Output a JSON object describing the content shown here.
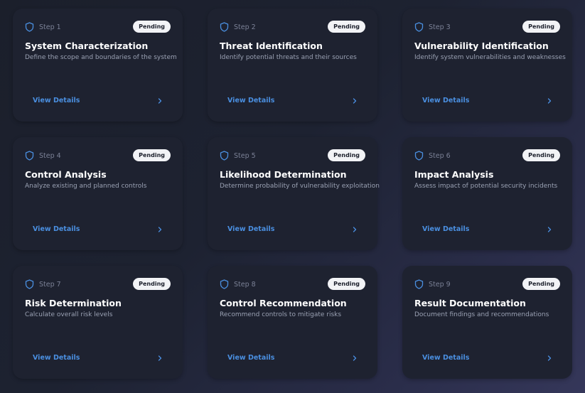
{
  "colors": {
    "accent": "#4a8fe0",
    "card_bg": "#1e2230",
    "badge_bg": "#f2f3f6"
  },
  "cards": [
    {
      "step": "Step 1",
      "status": "Pending",
      "title": "System Characterization",
      "description": "Define the scope and boundaries of the system",
      "action": "View Details"
    },
    {
      "step": "Step 2",
      "status": "Pending",
      "title": "Threat Identification",
      "description": "Identify potential threats and their sources",
      "action": "View Details"
    },
    {
      "step": "Step 3",
      "status": "Pending",
      "title": "Vulnerability Identification",
      "description": "Identify system vulnerabilities and weaknesses",
      "action": "View Details"
    },
    {
      "step": "Step 4",
      "status": "Pending",
      "title": "Control Analysis",
      "description": "Analyze existing and planned controls",
      "action": "View Details"
    },
    {
      "step": "Step 5",
      "status": "Pending",
      "title": "Likelihood Determination",
      "description": "Determine probability of vulnerability exploitation",
      "action": "View Details"
    },
    {
      "step": "Step 6",
      "status": "Pending",
      "title": "Impact Analysis",
      "description": "Assess impact of potential security incidents",
      "action": "View Details"
    },
    {
      "step": "Step 7",
      "status": "Pending",
      "title": "Risk Determination",
      "description": "Calculate overall risk levels",
      "action": "View Details"
    },
    {
      "step": "Step 8",
      "status": "Pending",
      "title": "Control Recommendation",
      "description": "Recommend controls to mitigate risks",
      "action": "View Details"
    },
    {
      "step": "Step 9",
      "status": "Pending",
      "title": "Result Documentation",
      "description": "Document findings and recommendations",
      "action": "View Details"
    }
  ]
}
